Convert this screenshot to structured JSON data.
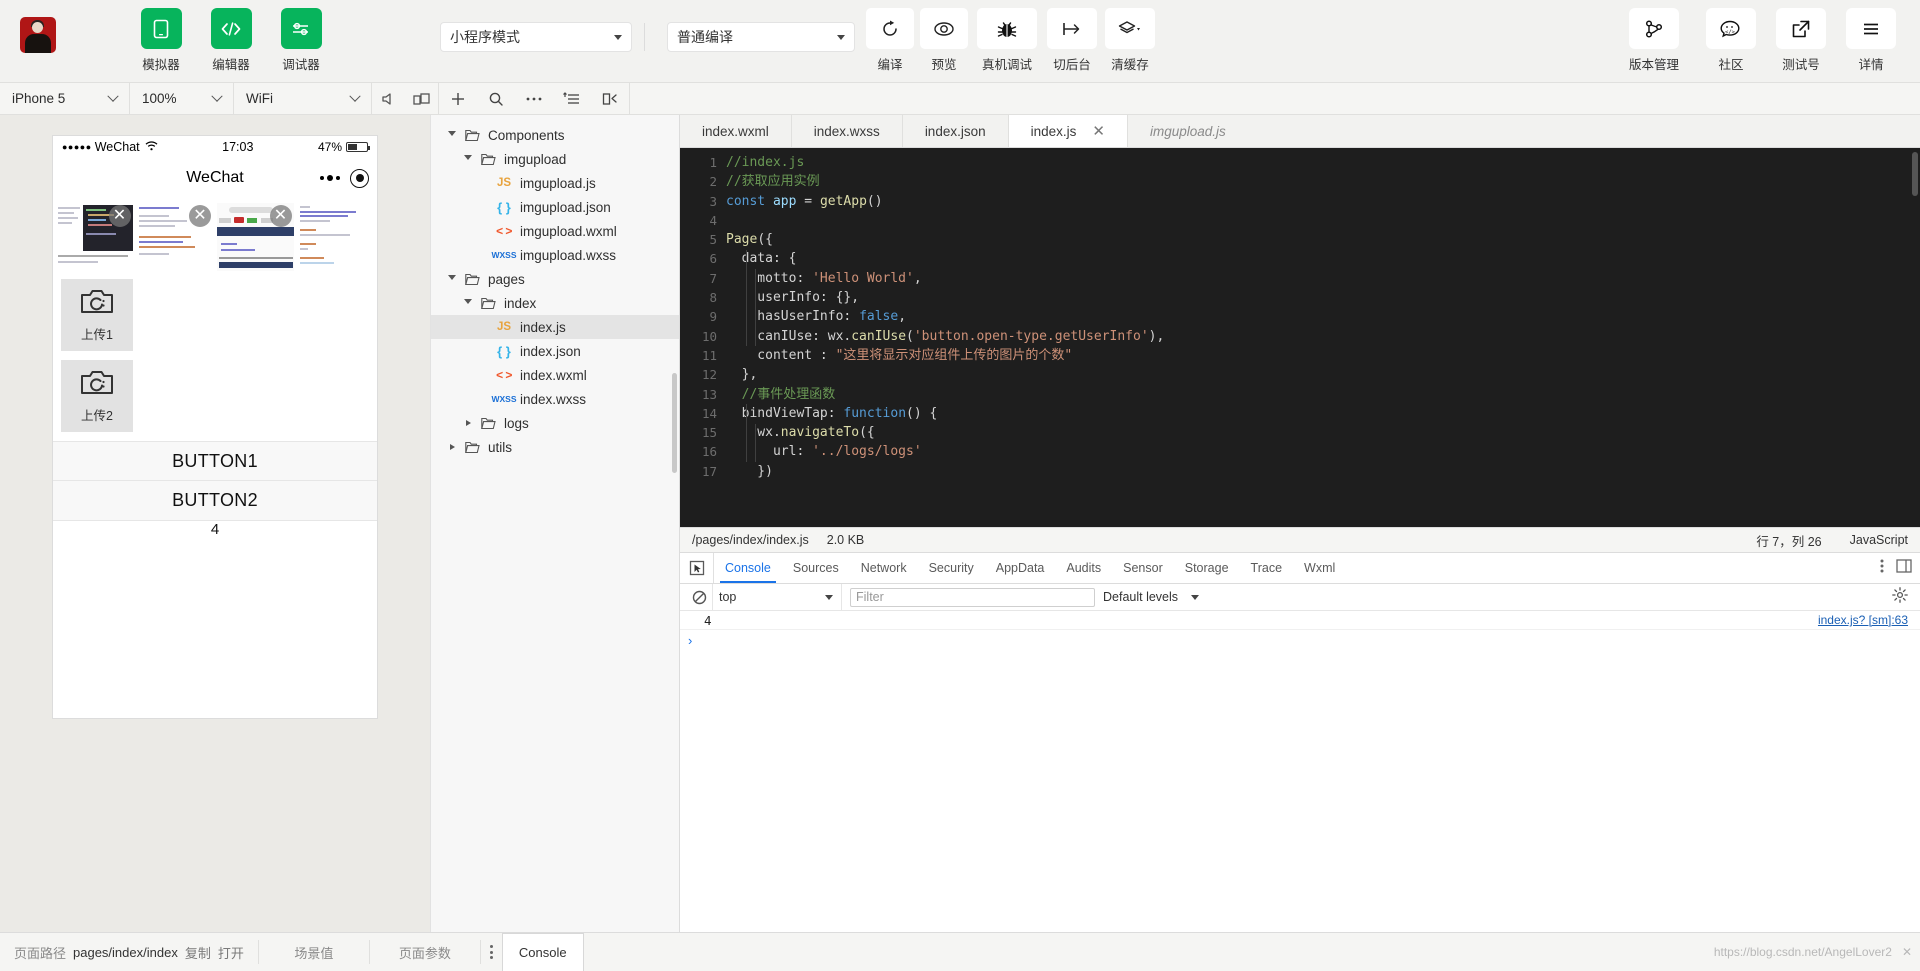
{
  "toolbar": {
    "left_buttons": [
      {
        "label": "模拟器",
        "icon": "simulator-icon"
      },
      {
        "label": "编辑器",
        "icon": "code-icon"
      },
      {
        "label": "调试器",
        "icon": "debugger-icon"
      }
    ],
    "mode_select": "小程序模式",
    "compile_select": "普通编译",
    "actions": [
      {
        "label": "编译",
        "icon": "refresh-icon"
      },
      {
        "label": "预览",
        "icon": "eye-icon"
      },
      {
        "label": "真机调试",
        "icon": "bug-icon"
      },
      {
        "label": "切后台",
        "icon": "background-icon"
      },
      {
        "label": "清缓存",
        "icon": "layers-icon"
      }
    ],
    "right_actions": [
      {
        "label": "版本管理",
        "icon": "branch-icon"
      },
      {
        "label": "社区",
        "icon": "community-icon"
      },
      {
        "label": "测试号",
        "icon": "external-link-icon"
      },
      {
        "label": "详情",
        "icon": "menu-icon"
      }
    ]
  },
  "simbar": {
    "device": "iPhone 5",
    "zoom": "100%",
    "network": "WiFi",
    "icons": [
      "volume-icon",
      "rotate-icon",
      "add-icon",
      "search-icon",
      "more-icon",
      "outline-icon",
      "split-icon"
    ]
  },
  "simulator": {
    "status": {
      "carrier": "WeChat",
      "dots": "●●●●●",
      "time": "17:03",
      "battery": "47%"
    },
    "nav_title": "WeChat",
    "upload_buttons": [
      {
        "label": "上传1",
        "icon": "camera-icon"
      },
      {
        "label": "上传2",
        "icon": "camera-icon"
      }
    ],
    "buttons": [
      "BUTTON1",
      "BUTTON2"
    ],
    "content_value": "4"
  },
  "explorer": {
    "tree": [
      {
        "depth": 0,
        "label": "Components",
        "type": "folder",
        "open": true
      },
      {
        "depth": 1,
        "label": "imgupload",
        "type": "folder",
        "open": true
      },
      {
        "depth": 2,
        "label": "imgupload.js",
        "type": "js"
      },
      {
        "depth": 2,
        "label": "imgupload.json",
        "type": "json"
      },
      {
        "depth": 2,
        "label": "imgupload.wxml",
        "type": "wxml"
      },
      {
        "depth": 2,
        "label": "imgupload.wxss",
        "type": "wxss"
      },
      {
        "depth": 0,
        "label": "pages",
        "type": "folder",
        "open": true
      },
      {
        "depth": 1,
        "label": "index",
        "type": "folder",
        "open": true
      },
      {
        "depth": 2,
        "label": "index.js",
        "type": "js",
        "selected": true
      },
      {
        "depth": 2,
        "label": "index.json",
        "type": "json"
      },
      {
        "depth": 2,
        "label": "index.wxml",
        "type": "wxml"
      },
      {
        "depth": 2,
        "label": "index.wxss",
        "type": "wxss"
      },
      {
        "depth": 1,
        "label": "logs",
        "type": "folder",
        "open": false
      },
      {
        "depth": 0,
        "label": "utils",
        "type": "folder",
        "open": false
      }
    ]
  },
  "editor": {
    "tabs": [
      {
        "label": "index.wxml",
        "active": false,
        "italic": false
      },
      {
        "label": "index.wxss",
        "active": false,
        "italic": false
      },
      {
        "label": "index.json",
        "active": false,
        "italic": false
      },
      {
        "label": "index.js",
        "active": true,
        "italic": false,
        "closable": true
      },
      {
        "label": "imgupload.js",
        "active": false,
        "italic": true
      }
    ],
    "lines": [
      {
        "n": 1,
        "tokens": [
          {
            "t": "//index.js",
            "c": "c-com"
          }
        ]
      },
      {
        "n": 2,
        "tokens": [
          {
            "t": "//获取应用实例",
            "c": "c-com"
          }
        ]
      },
      {
        "n": 3,
        "tokens": [
          {
            "t": "const",
            "c": "c-kw"
          },
          {
            "t": " app ",
            "c": "c-id"
          },
          {
            "t": "= ",
            "c": "c-pl"
          },
          {
            "t": "getApp",
            "c": "c-fn"
          },
          {
            "t": "()",
            "c": "c-pl"
          }
        ]
      },
      {
        "n": 4,
        "tokens": [
          {
            "t": "",
            "c": "c-pl"
          }
        ]
      },
      {
        "n": 5,
        "tokens": [
          {
            "t": "Page",
            "c": "c-fn"
          },
          {
            "t": "({",
            "c": "c-pl"
          }
        ]
      },
      {
        "n": 6,
        "tokens": [
          {
            "t": "  data: {",
            "c": "c-pl"
          }
        ]
      },
      {
        "n": 7,
        "tokens": [
          {
            "t": "    motto: ",
            "c": "c-pl"
          },
          {
            "t": "'Hello World'",
            "c": "c-str"
          },
          {
            "t": ",",
            "c": "c-pl"
          }
        ]
      },
      {
        "n": 8,
        "tokens": [
          {
            "t": "    userInfo: {},",
            "c": "c-pl"
          }
        ]
      },
      {
        "n": 9,
        "tokens": [
          {
            "t": "    hasUserInfo: ",
            "c": "c-pl"
          },
          {
            "t": "false",
            "c": "c-kw"
          },
          {
            "t": ",",
            "c": "c-pl"
          }
        ]
      },
      {
        "n": 10,
        "tokens": [
          {
            "t": "    canIUse: wx.",
            "c": "c-pl"
          },
          {
            "t": "canIUse",
            "c": "c-fn"
          },
          {
            "t": "(",
            "c": "c-pl"
          },
          {
            "t": "'button.open-type.getUserInfo'",
            "c": "c-str"
          },
          {
            "t": "),",
            "c": "c-pl"
          }
        ]
      },
      {
        "n": 11,
        "tokens": [
          {
            "t": "    content : ",
            "c": "c-pl"
          },
          {
            "t": "\"这里将显示对应组件上传的图片的个数\"",
            "c": "c-str"
          }
        ]
      },
      {
        "n": 12,
        "tokens": [
          {
            "t": "  },",
            "c": "c-pl"
          }
        ]
      },
      {
        "n": 13,
        "tokens": [
          {
            "t": "  //事件处理函数",
            "c": "c-com"
          }
        ]
      },
      {
        "n": 14,
        "tokens": [
          {
            "t": "  bindViewTap: ",
            "c": "c-pl"
          },
          {
            "t": "function",
            "c": "c-kw"
          },
          {
            "t": "() {",
            "c": "c-pl"
          }
        ]
      },
      {
        "n": 15,
        "tokens": [
          {
            "t": "    wx.",
            "c": "c-pl"
          },
          {
            "t": "navigateTo",
            "c": "c-fn"
          },
          {
            "t": "({",
            "c": "c-pl"
          }
        ]
      },
      {
        "n": 16,
        "tokens": [
          {
            "t": "      url: ",
            "c": "c-pl"
          },
          {
            "t": "'../logs/logs'",
            "c": "c-str"
          }
        ]
      },
      {
        "n": 17,
        "tokens": [
          {
            "t": "    })",
            "c": "c-pl"
          }
        ]
      }
    ],
    "status": {
      "path": "/pages/index/index.js",
      "size": "2.0 KB",
      "cursor": "行 7，列 26",
      "language": "JavaScript"
    }
  },
  "devtools": {
    "tabs": [
      {
        "label": "Console",
        "active": true
      },
      {
        "label": "Sources",
        "active": false
      },
      {
        "label": "Network",
        "active": false
      },
      {
        "label": "Security",
        "active": false
      },
      {
        "label": "AppData",
        "active": false
      },
      {
        "label": "Audits",
        "active": false
      },
      {
        "label": "Sensor",
        "active": false
      },
      {
        "label": "Storage",
        "active": false
      },
      {
        "label": "Trace",
        "active": false
      },
      {
        "label": "Wxml",
        "active": false
      }
    ],
    "context": "top",
    "filter_placeholder": "Filter",
    "levels": "Default levels",
    "logs": [
      {
        "text": "4",
        "source": "index.js? [sm]:63"
      }
    ],
    "prompt": "›"
  },
  "bottom": {
    "path_label": "页面路径",
    "path_value": "pages/index/index",
    "copy": "复制",
    "open": "打开",
    "scene": "场景值",
    "params": "页面参数",
    "console_tab": "Console",
    "watermark": "https://blog.csdn.net/AngelLover2"
  },
  "colors": {
    "accent_green": "#07b45c",
    "editor_bg": "#1e1e1e",
    "devtools_blue": "#1a73e8"
  }
}
